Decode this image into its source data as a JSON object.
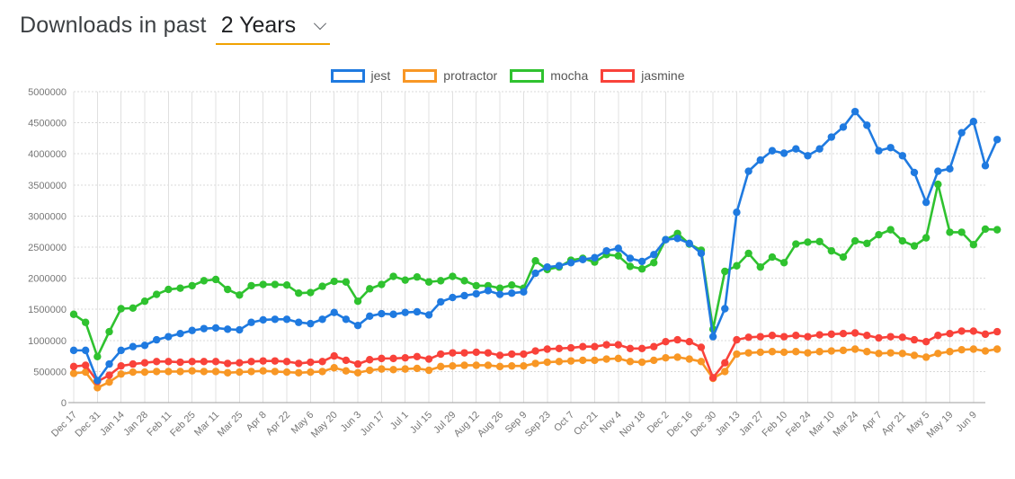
{
  "header": {
    "title": "Downloads in past",
    "range_value": "2 Years",
    "chevron_icon": "chevron-down-icon",
    "underline_color": "#f0a202"
  },
  "legend": {
    "position": "top-center",
    "items": [
      {
        "label": "jest",
        "color": "#1f7ae0"
      },
      {
        "label": "protractor",
        "color": "#f89725"
      },
      {
        "label": "mocha",
        "color": "#2fc22f"
      },
      {
        "label": "jasmine",
        "color": "#f9423a"
      }
    ]
  },
  "chart_data": {
    "type": "line",
    "title": "Downloads in past 2 Years",
    "xlabel": "",
    "ylabel": "",
    "grid": true,
    "legend_position": "top-center",
    "ylim": [
      0,
      5000000
    ],
    "ytick_step": 500000,
    "ytick_labels": [
      "0",
      "500000",
      "1000000",
      "1500000",
      "2000000",
      "2500000",
      "3000000",
      "3500000",
      "4000000",
      "4500000",
      "5000000"
    ],
    "xtick_labels": [
      "Dec 17",
      "Dec 31",
      "Jan 14",
      "Jan 28",
      "Feb 11",
      "Feb 25",
      "Mar 11",
      "Mar 25",
      "Apr 8",
      "Apr 22",
      "May 6",
      "May 20",
      "Jun 3",
      "Jun 17",
      "Jul 1",
      "Jul 15",
      "Jul 29",
      "Aug 12",
      "Aug 26",
      "Sep 9",
      "Sep 23",
      "Oct 7",
      "Oct 21",
      "Nov 4",
      "Nov 18",
      "Dec 2",
      "Dec 16",
      "Dec 30",
      "Jan 13",
      "Jan 27",
      "Feb 10",
      "Feb 24",
      "Mar 10",
      "Mar 24",
      "Apr 7",
      "Apr 21",
      "May 5",
      "May 19",
      "Jun 9"
    ],
    "xtick_every": 2,
    "x": [
      "Dec 17",
      "Dec 24",
      "Dec 31",
      "Jan 7",
      "Jan 14",
      "Jan 21",
      "Jan 28",
      "Feb 4",
      "Feb 11",
      "Feb 18",
      "Feb 25",
      "Mar 4",
      "Mar 11",
      "Mar 18",
      "Mar 25",
      "Apr 1",
      "Apr 8",
      "Apr 15",
      "Apr 22",
      "Apr 29",
      "May 6",
      "May 13",
      "May 20",
      "May 27",
      "Jun 3",
      "Jun 10",
      "Jun 17",
      "Jun 24",
      "Jul 1",
      "Jul 8",
      "Jul 15",
      "Jul 22",
      "Jul 29",
      "Aug 5",
      "Aug 12",
      "Aug 19",
      "Aug 26",
      "Sep 2",
      "Sep 9",
      "Sep 16",
      "Sep 23",
      "Sep 30",
      "Oct 7",
      "Oct 14",
      "Oct 21",
      "Oct 28",
      "Nov 4",
      "Nov 11",
      "Nov 18",
      "Nov 25",
      "Dec 2",
      "Dec 9",
      "Dec 16",
      "Dec 23",
      "Dec 30",
      "Jan 6",
      "Jan 13",
      "Jan 20",
      "Jan 27",
      "Feb 3",
      "Feb 10",
      "Feb 17",
      "Feb 24",
      "Mar 3",
      "Mar 10",
      "Mar 17",
      "Mar 24",
      "Mar 31",
      "Apr 7",
      "Apr 14",
      "Apr 21",
      "Apr 28",
      "May 5",
      "May 12",
      "May 19",
      "May 26",
      "Jun 2",
      "Jun 9"
    ],
    "series": [
      {
        "name": "jest",
        "color": "#1f7ae0",
        "values": [
          840000,
          840000,
          355000,
          620000,
          840000,
          900000,
          920000,
          1010000,
          1060000,
          1110000,
          1160000,
          1190000,
          1200000,
          1180000,
          1170000,
          1290000,
          1330000,
          1340000,
          1340000,
          1290000,
          1270000,
          1340000,
          1450000,
          1340000,
          1240000,
          1390000,
          1430000,
          1420000,
          1450000,
          1460000,
          1410000,
          1620000,
          1690000,
          1720000,
          1750000,
          1800000,
          1740000,
          1760000,
          1780000,
          2080000,
          2180000,
          2200000,
          2250000,
          2300000,
          2330000,
          2440000,
          2480000,
          2320000,
          2270000,
          2380000,
          2620000,
          2640000,
          2560000,
          2400000,
          1060000,
          1510000,
          3060000,
          3720000,
          3900000,
          4050000,
          4010000,
          4080000,
          3970000,
          4080000,
          4270000,
          4430000,
          4680000,
          4460000,
          4050000,
          4100000,
          3970000,
          3700000,
          3220000,
          3720000,
          3760000,
          4340000,
          4520000,
          3810000,
          4230000
        ]
      },
      {
        "name": "protractor",
        "color": "#f89725",
        "values": [
          470000,
          490000,
          240000,
          330000,
          460000,
          490000,
          490000,
          500000,
          500000,
          500000,
          510000,
          500000,
          500000,
          480000,
          490000,
          500000,
          510000,
          500000,
          490000,
          480000,
          490000,
          500000,
          560000,
          510000,
          480000,
          520000,
          540000,
          530000,
          540000,
          550000,
          520000,
          580000,
          590000,
          600000,
          600000,
          600000,
          580000,
          590000,
          590000,
          630000,
          650000,
          660000,
          670000,
          680000,
          680000,
          700000,
          710000,
          660000,
          650000,
          680000,
          720000,
          730000,
          700000,
          660000,
          390000,
          500000,
          780000,
          800000,
          810000,
          820000,
          810000,
          820000,
          800000,
          820000,
          830000,
          840000,
          860000,
          820000,
          790000,
          800000,
          790000,
          760000,
          730000,
          790000,
          820000,
          850000,
          860000,
          830000,
          860000
        ]
      },
      {
        "name": "mocha",
        "color": "#2fc22f",
        "values": [
          1420000,
          1290000,
          740000,
          1140000,
          1510000,
          1520000,
          1630000,
          1740000,
          1820000,
          1840000,
          1880000,
          1960000,
          1980000,
          1820000,
          1730000,
          1880000,
          1900000,
          1900000,
          1890000,
          1760000,
          1770000,
          1870000,
          1950000,
          1940000,
          1630000,
          1830000,
          1900000,
          2030000,
          1970000,
          2020000,
          1940000,
          1960000,
          2030000,
          1960000,
          1880000,
          1880000,
          1840000,
          1890000,
          1840000,
          2280000,
          2140000,
          2180000,
          2290000,
          2320000,
          2260000,
          2380000,
          2360000,
          2190000,
          2150000,
          2250000,
          2620000,
          2720000,
          2550000,
          2450000,
          1180000,
          2110000,
          2200000,
          2400000,
          2180000,
          2340000,
          2250000,
          2550000,
          2580000,
          2590000,
          2440000,
          2340000,
          2600000,
          2560000,
          2700000,
          2780000,
          2600000,
          2520000,
          2650000,
          3510000,
          2740000,
          2740000,
          2540000,
          2790000,
          2780000
        ]
      },
      {
        "name": "jasmine",
        "color": "#f9423a",
        "values": [
          580000,
          600000,
          340000,
          440000,
          590000,
          620000,
          640000,
          660000,
          660000,
          650000,
          660000,
          660000,
          660000,
          630000,
          640000,
          660000,
          670000,
          670000,
          660000,
          630000,
          650000,
          660000,
          750000,
          680000,
          620000,
          690000,
          710000,
          710000,
          720000,
          740000,
          700000,
          780000,
          800000,
          800000,
          810000,
          800000,
          760000,
          780000,
          780000,
          830000,
          860000,
          870000,
          880000,
          900000,
          900000,
          930000,
          930000,
          870000,
          870000,
          900000,
          980000,
          1010000,
          980000,
          890000,
          400000,
          640000,
          1010000,
          1050000,
          1060000,
          1080000,
          1060000,
          1080000,
          1060000,
          1090000,
          1100000,
          1110000,
          1120000,
          1080000,
          1040000,
          1060000,
          1050000,
          1010000,
          980000,
          1080000,
          1110000,
          1150000,
          1150000,
          1100000,
          1140000
        ]
      }
    ]
  }
}
